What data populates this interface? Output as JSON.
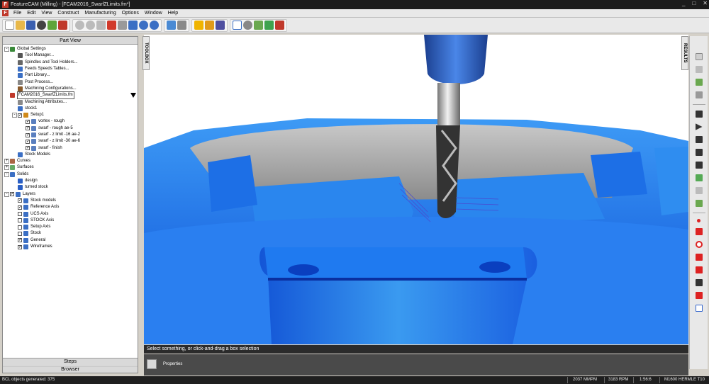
{
  "window": {
    "title": "FeatureCAM (Milling) - [FCAM2016_SwarfZLimits.fm*]",
    "controls": [
      "_",
      "□",
      "✕"
    ]
  },
  "menu": {
    "items": [
      "File",
      "Edit",
      "View",
      "Construct",
      "Manufacturing",
      "Options",
      "Window",
      "Help"
    ]
  },
  "part_view": {
    "header": "Part View",
    "tree": [
      {
        "label": "Global Settings",
        "level": 0,
        "icon": "globe-icon",
        "exp": "-"
      },
      {
        "label": "Tool Manager...",
        "level": 1,
        "icon": "tool-icon"
      },
      {
        "label": "Spindles and Tool Holders...",
        "level": 1,
        "icon": "spindle-icon"
      },
      {
        "label": "Feeds  Speeds Tables...",
        "level": 1,
        "icon": "table-icon"
      },
      {
        "label": "Part Library...",
        "level": 1,
        "icon": "library-icon"
      },
      {
        "label": "Post Process...",
        "level": 1,
        "icon": "post-icon"
      },
      {
        "label": "Machining Configurations...",
        "level": 1,
        "icon": "config-icon"
      },
      {
        "label": "FCAM2016_SwarfZLimits.fm",
        "level": 0,
        "icon": "document-icon",
        "boxed": true
      },
      {
        "label": "Machining Attributes...",
        "level": 1,
        "icon": "attributes-icon"
      },
      {
        "label": "stock1",
        "level": 1,
        "icon": "stock-icon"
      },
      {
        "label": "Setup1",
        "level": 1,
        "icon": "setup-icon",
        "exp": "-",
        "cb": true
      },
      {
        "label": "vortex - rough",
        "level": 2,
        "icon": "operation-icon",
        "cb": true
      },
      {
        "label": "swarf - rough ae-5",
        "level": 2,
        "icon": "operation-icon",
        "cb": true
      },
      {
        "label": "swarf - z limit -16 ae-2",
        "level": 2,
        "icon": "operation-icon",
        "cb": true
      },
      {
        "label": "swarf - z limit -30 ae-6",
        "level": 2,
        "icon": "operation-icon",
        "cb": true
      },
      {
        "label": "swarf - finish",
        "level": 2,
        "icon": "operation-icon",
        "cb": true
      },
      {
        "label": "Stock Models",
        "level": 1,
        "icon": "stock-models-icon"
      },
      {
        "label": "Curves",
        "level": 0,
        "icon": "curves-icon",
        "exp": "+"
      },
      {
        "label": "Surfaces",
        "level": 0,
        "icon": "surfaces-icon",
        "exp": "+"
      },
      {
        "label": "Solids",
        "level": 0,
        "icon": "solids-icon",
        "exp": "-"
      },
      {
        "label": "design",
        "level": 1,
        "icon": "solid-icon"
      },
      {
        "label": "turned stock",
        "level": 1,
        "icon": "solid-icon"
      },
      {
        "label": "Layers",
        "level": 0,
        "icon": "layers-icon",
        "exp": "-",
        "cb": true
      },
      {
        "label": "Stock models",
        "level": 1,
        "icon": "layer-icon",
        "cb": true
      },
      {
        "label": "Reference Axis",
        "level": 1,
        "icon": "layer-icon",
        "cb": true
      },
      {
        "label": "UCS Axis",
        "level": 1,
        "icon": "layer-icon",
        "cb": false
      },
      {
        "label": "STOCK Axis",
        "level": 1,
        "icon": "layer-icon",
        "cb": false
      },
      {
        "label": "Setup Axis",
        "level": 1,
        "icon": "layer-icon",
        "cb": false
      },
      {
        "label": "Stock",
        "level": 1,
        "icon": "layer-icon",
        "cb": false
      },
      {
        "label": "General",
        "level": 1,
        "icon": "layer-icon",
        "cb": true
      },
      {
        "label": "Wireframes",
        "level": 1,
        "icon": "layer-icon",
        "cb": true
      }
    ],
    "footer_steps": "Steps",
    "footer_browser": "Browser"
  },
  "side_labels": {
    "toolbox": "TOOLBOX",
    "results": "RESULTS"
  },
  "prompt_text": "Select something, or click-and-drag a box selection",
  "properties_label": "Properties",
  "status": {
    "left": "BCL objects generated: 375",
    "feed": "2037 MMPM",
    "speed": "3183 RPM",
    "time": "1:56:6",
    "machine": "M1600 HERMLE T10"
  },
  "colors": {
    "part_blue": "#1a73e8",
    "tool_blue": "#2a63c7",
    "accent_red": "#c0392b"
  }
}
